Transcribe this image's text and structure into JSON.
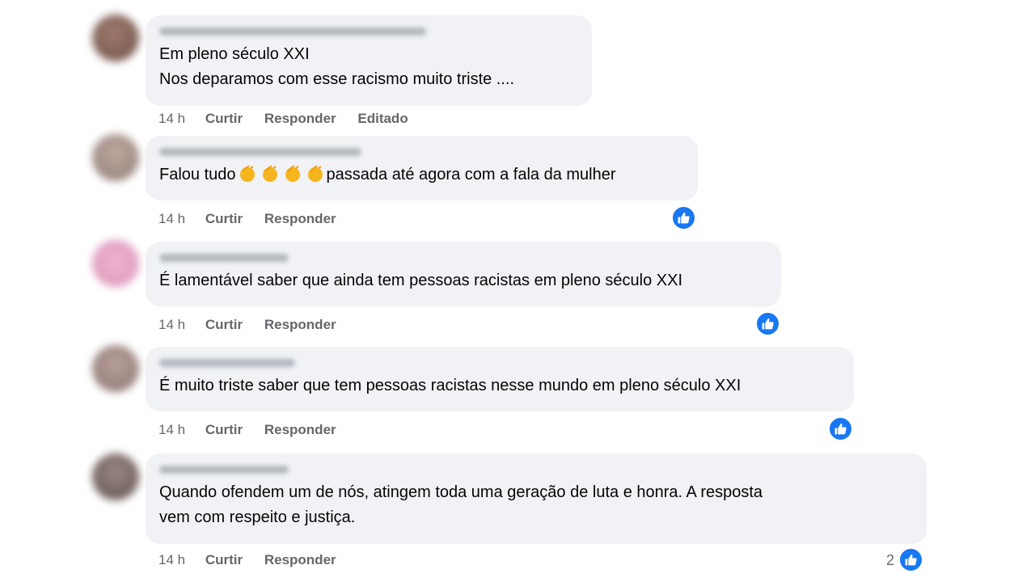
{
  "comments": [
    {
      "lines": [
        "Em pleno século XXI",
        "Nos deparamos com esse racismo muito triste ...."
      ],
      "time": "14 h",
      "like_label": "Curtir",
      "reply_label": "Responder",
      "edited_label": "Editado",
      "avatar_color": "#8a6a5e"
    },
    {
      "text_before": "Falou tudo",
      "text_after": "passada até agora com a fala da mulher",
      "emoji": [
        "clapping-hands-icon",
        "clapping-hands-icon",
        "clapping-hands-icon",
        "clapping-hands-icon"
      ],
      "time": "14 h",
      "like_label": "Curtir",
      "reply_label": "Responder",
      "avatar_color": "#a89890"
    },
    {
      "lines": [
        "É lamentável saber que ainda tem pessoas racistas em pleno século XXI"
      ],
      "time": "14 h",
      "like_label": "Curtir",
      "reply_label": "Responder",
      "avatar_color": "#e6a8c8"
    },
    {
      "lines": [
        "É muito triste saber que tem pessoas racistas nesse mundo em pleno século XXI"
      ],
      "time": "14 h",
      "like_label": "Curtir",
      "reply_label": "Responder",
      "avatar_color": "#a08a84"
    },
    {
      "lines": [
        "Quando ofendem um de nós, atingem toda uma geração de luta e honra. A resposta",
        "vem com respeito e justiça."
      ],
      "time": "14 h",
      "like_label": "Curtir",
      "reply_label": "Responder",
      "reaction_count": "2",
      "avatar_color": "#7a6a66"
    }
  ],
  "colors": {
    "bubble": "#f0f2f5",
    "meta_text": "#65676b",
    "like_blue": "#1877f2"
  }
}
